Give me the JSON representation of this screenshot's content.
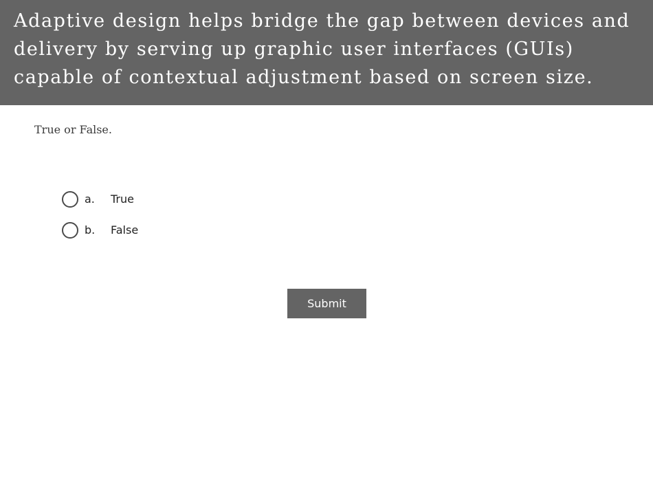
{
  "question": {
    "text": "Adaptive design helps bridge the gap between devices and delivery by serving up graphic user interfaces (GUIs) capable of contextual adjustment based on screen size.",
    "instruction": "True or False."
  },
  "options": [
    {
      "letter": "a.",
      "label": "True",
      "selected": false
    },
    {
      "letter": "b.",
      "label": "False",
      "selected": false
    }
  ],
  "submit": {
    "label": "Submit"
  },
  "colors": {
    "header_background": "#646464",
    "button_background": "#646464",
    "header_text": "#ffffff"
  }
}
